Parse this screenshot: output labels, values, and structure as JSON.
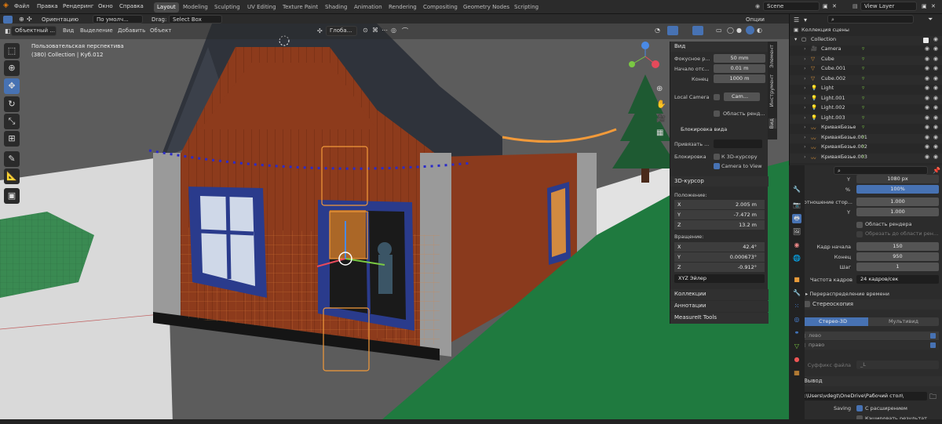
{
  "menu": [
    "Файл",
    "Правка",
    "Рендеринг",
    "Окно",
    "Справка"
  ],
  "workspaces": [
    "Layout",
    "Modeling",
    "Sculpting",
    "UV Editing",
    "Texture Paint",
    "Shading",
    "Animation",
    "Rendering",
    "Compositing",
    "Geometry Nodes",
    "Scripting"
  ],
  "scene": {
    "name": "Scene",
    "view_layer": "View Layer"
  },
  "header": {
    "orientation_label": "Ориентацию",
    "orientation_value": "По умолч...",
    "drag_label": "Drag:",
    "drag_value": "Select Box",
    "options_label": "Опции",
    "global_label": "Глоба...",
    "mode": "Объектный ...",
    "menus": [
      "Вид",
      "Выделение",
      "Добавить",
      "Объект"
    ]
  },
  "viewport": {
    "perspective": "Пользовательская перспектива",
    "collection_info": "(380) Collection | Куб.012"
  },
  "npanel": {
    "view_title": "Вид",
    "focal_label": "Фокусное р...",
    "focal_value": "50 mm",
    "clip_start_label": "Начало отс...",
    "clip_start_value": "0.01 m",
    "clip_end_label": "Конец",
    "clip_end_value": "1000 m",
    "local_camera_label": "Local Camera",
    "local_camera_value": "Cam...",
    "render_region_label": "Область ренд...",
    "view_lock_title": "Блокировка вида",
    "lock_to_label": "Привязать ...",
    "lock_label": "Блокировка",
    "lock_cursor_label": "К 3D-курсору",
    "camera_to_view_label": "Camera to View",
    "cursor_title": "3D-курсор",
    "location_label": "Положение:",
    "loc": [
      {
        "axis": "X",
        "value": "2.005 m"
      },
      {
        "axis": "Y",
        "value": "-7.472 m"
      },
      {
        "axis": "Z",
        "value": "13.2 m"
      }
    ],
    "rotation_label": "Вращение:",
    "rot": [
      {
        "axis": "X",
        "value": "42.4°"
      },
      {
        "axis": "Y",
        "value": "0.000673°"
      },
      {
        "axis": "Z",
        "value": "-0.912°"
      }
    ],
    "rot_mode": "XYZ Эйлер",
    "collapsed": [
      "Коллекции",
      "Аннотации",
      "MeasureIt Tools"
    ],
    "tabs": [
      "Элемент",
      "Инструмент",
      "Вид"
    ]
  },
  "outliner": {
    "root": "Коллекция сцены",
    "collection": "Collection",
    "items": [
      "Camera",
      "Cube",
      "Cube.001",
      "Cube.002",
      "Light",
      "Light.001",
      "Light.002",
      "Light.003",
      "КриваяБезье",
      "КриваяБезье.001",
      "КриваяБезье.002",
      "КриваяБезье.003"
    ]
  },
  "props": {
    "y_label": "Y",
    "y_value": "1080 px",
    "percent_label": "%",
    "percent_value": "100%",
    "aspect_label": "Соотношение стор...",
    "aspect_x": "1.000",
    "aspect_y_label": "Y",
    "aspect_y": "1.000",
    "render_region_label": "Область рендера",
    "crop_label": "Обрезать до области рен...",
    "frame_start_label": "Кадр начала",
    "frame_start": "150",
    "frame_end_label": "Конец",
    "frame_end": "950",
    "step_label": "Шаг",
    "step": "1",
    "fps_label": "Частота кадров",
    "fps_value": "24 кадров/сек",
    "time_remap_label": "Перераспределение времени",
    "stereo_label": "Стереоскопия",
    "stereo_tab": "Стерео-3D",
    "multiview_tab": "Мультивид",
    "left_label": "лево",
    "right_label": "право",
    "suffix_label": "Суффикс файла",
    "suffix_value": "_L",
    "output_label": "Вывод",
    "path_value": "C:\\Users\\vdegt\\OneDrive\\Рабочий стол\\",
    "saving_label": "Saving",
    "extension_label": "С расширением",
    "cache_label": "Кэшировать результат"
  },
  "colors": {
    "accent": "#4772b3",
    "selection_orange": "#f29a3a",
    "roof": "#2f333b",
    "walls": "#8a3a1d",
    "grass": "#2a8f4a",
    "window_frame": "#2a3b8c"
  }
}
